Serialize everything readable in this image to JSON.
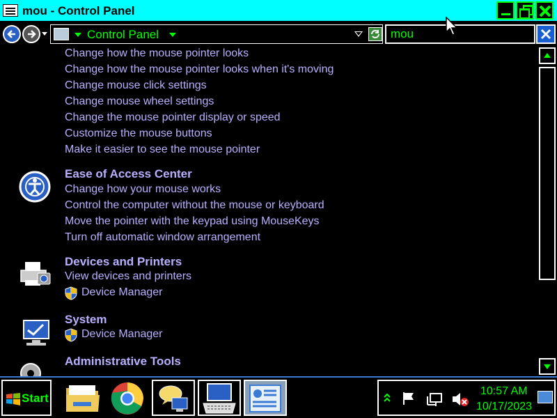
{
  "window": {
    "title": "mou - Control Panel"
  },
  "address": {
    "path": "Control Panel",
    "search_value": "mou"
  },
  "results": {
    "mouse_links": [
      "Change how the mouse pointer looks",
      "Change how the mouse pointer looks when it's moving",
      "Change mouse click settings",
      "Change mouse wheel settings",
      "Change the mouse pointer display or speed",
      "Customize the mouse buttons",
      "Make it easier to see the mouse pointer"
    ],
    "ease": {
      "heading": "Ease of Access Center",
      "links": [
        "Change how your mouse works",
        "Control the computer without the mouse or keyboard",
        "Move the pointer with the keypad using MouseKeys",
        "Turn off automatic window arrangement"
      ]
    },
    "devices": {
      "heading": "Devices and Printers",
      "links": [
        "View devices and printers",
        "Device Manager"
      ]
    },
    "system": {
      "heading": "System",
      "links": [
        "Device Manager"
      ]
    },
    "admin": {
      "heading": "Administrative Tools"
    }
  },
  "taskbar": {
    "start_label": "Start",
    "items": [
      "file-explorer",
      "chrome",
      "communication-app",
      "keyboard-settings",
      "control-panel"
    ],
    "clock_time": "10:57 AM",
    "clock_date": "10/17/2023"
  },
  "colors": {
    "titlebar": "#00ffff",
    "accent_text": "#00ff00",
    "link": "#b8b0ff"
  }
}
